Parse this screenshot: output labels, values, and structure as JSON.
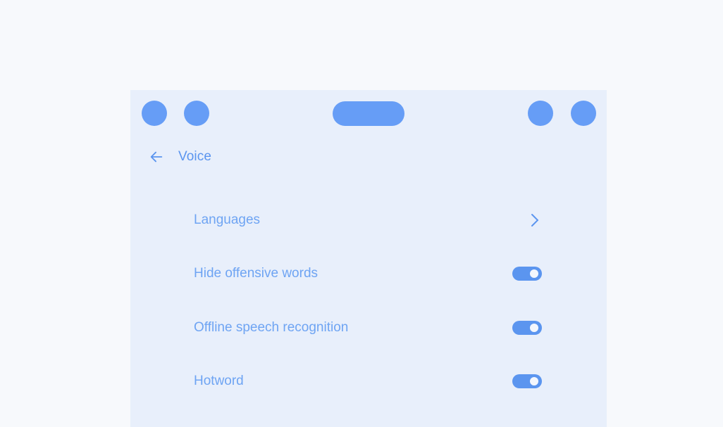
{
  "status_bar": {
    "left_dots": 2,
    "right_dots": 2
  },
  "header": {
    "title": "Voice",
    "back_icon": "arrow-left-icon"
  },
  "settings": [
    {
      "id": "languages",
      "label": "Languages",
      "control": "chevron",
      "icon": "chevron-right-icon"
    },
    {
      "id": "hide-offensive-words",
      "label": "Hide offensive words",
      "control": "toggle",
      "on": true
    },
    {
      "id": "offline-speech-recognition",
      "label": "Offline speech recognition",
      "control": "toggle",
      "on": true
    },
    {
      "id": "hotword",
      "label": "Hotword",
      "control": "toggle",
      "on": true
    }
  ],
  "colors": {
    "accent": "#669df6",
    "title": "#5b95ef",
    "label": "#6ea4f3",
    "panel_bg": "#e8effb",
    "page_bg": "#f7f9fc"
  }
}
